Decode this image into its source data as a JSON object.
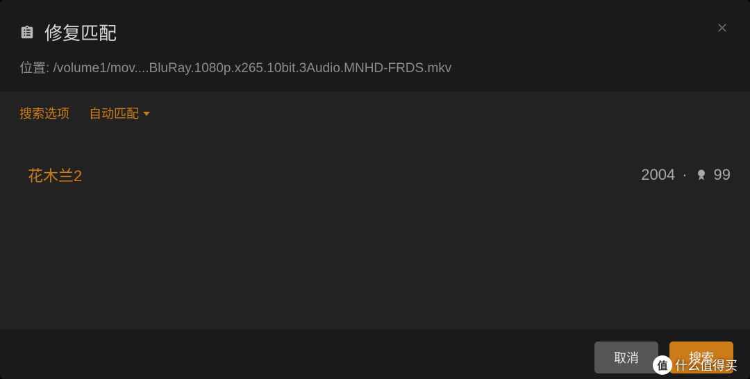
{
  "header": {
    "title": "修复匹配",
    "path_label": "位置:",
    "path_value": "/volume1/mov....BluRay.1080p.x265.10bit.3Audio.MNHD-FRDS.mkv"
  },
  "toolbar": {
    "search_options_label": "搜索选项",
    "auto_match_label": "自动匹配"
  },
  "results": [
    {
      "title": "花木兰2",
      "year": "2004",
      "score": "99"
    }
  ],
  "footer": {
    "cancel_label": "取消",
    "search_label": "搜索"
  },
  "watermark": {
    "text": "什么值得买",
    "badge": "值"
  }
}
